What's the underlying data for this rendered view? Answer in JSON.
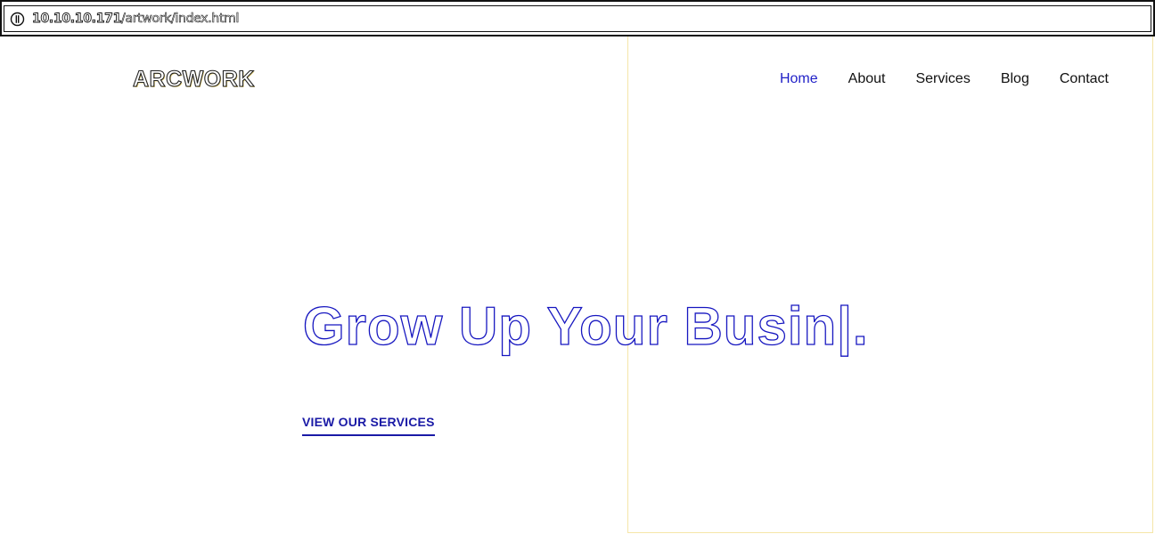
{
  "browser": {
    "url_host": "10.10.10.171",
    "url_path": "/artwork/index.html",
    "info_icon": "info-icon"
  },
  "header": {
    "logo": "ARCWORK",
    "nav": [
      {
        "label": "Home",
        "active": true
      },
      {
        "label": "About",
        "active": false
      },
      {
        "label": "Services",
        "active": false
      },
      {
        "label": "Blog",
        "active": false
      },
      {
        "label": "Contact",
        "active": false
      }
    ]
  },
  "hero": {
    "title": "Grow Up Your Busin|.",
    "cta_label": "VIEW OUR SERVICES"
  },
  "colors": {
    "accent": "#1f1fc7",
    "cta": "#1a1aa6",
    "panel_border": "#f5e6a8"
  }
}
